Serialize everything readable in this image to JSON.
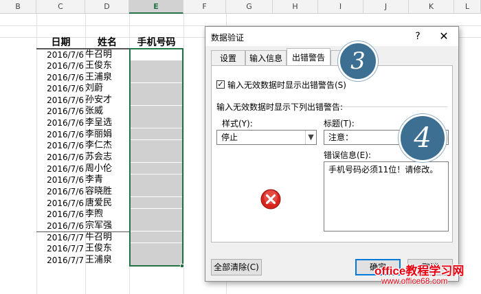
{
  "sheet": {
    "columns": [
      "B",
      "C",
      "D",
      "E",
      "F",
      "G",
      "H",
      "I",
      "J",
      "K",
      "L"
    ],
    "selected_column": "E",
    "headers": {
      "date": "日期",
      "name": "姓名",
      "phone": "手机号码"
    },
    "rows": [
      {
        "date": "2016/7/6",
        "name": "牛召明"
      },
      {
        "date": "2016/7/6",
        "name": "王俊东"
      },
      {
        "date": "2016/7/6",
        "name": "王浦泉"
      },
      {
        "date": "2016/7/6",
        "name": "刘蔚"
      },
      {
        "date": "2016/7/6",
        "name": "孙安才"
      },
      {
        "date": "2016/7/6",
        "name": "张威"
      },
      {
        "date": "2016/7/6",
        "name": "李呈选"
      },
      {
        "date": "2016/7/6",
        "name": "李丽娟"
      },
      {
        "date": "2016/7/6",
        "name": "李仁杰"
      },
      {
        "date": "2016/7/6",
        "name": "苏会志"
      },
      {
        "date": "2016/7/6",
        "name": "周小伦"
      },
      {
        "date": "2016/7/6",
        "name": "李青"
      },
      {
        "date": "2016/7/6",
        "name": "容晓胜"
      },
      {
        "date": "2016/7/6",
        "name": "唐爱民"
      },
      {
        "date": "2016/7/6",
        "name": "李煦"
      },
      {
        "date": "2016/7/6",
        "name": "宗军强"
      },
      {
        "date": "2016/7/7",
        "name": "牛召明"
      },
      {
        "date": "2016/7/7",
        "name": "王俊东"
      },
      {
        "date": "2016/7/7",
        "name": "王浦泉"
      }
    ]
  },
  "dialog": {
    "title": "数据验证",
    "help": "?",
    "close": "✕",
    "tabs": [
      "设置",
      "输入信息",
      "出错警告",
      ""
    ],
    "active_tab": "出错警告",
    "show_alert_checkbox": {
      "checked": true,
      "mark": "✓",
      "label": "输入无效数据时显示出错警告(S)"
    },
    "section_label": "输入无效数据时显示下列出错警告:",
    "style_label": "样式(Y):",
    "style_value": "停止",
    "title_label": "标题(T):",
    "title_value": "注意：",
    "message_label": "错误信息(E):",
    "message_value": "手机号码必须11位！请修改。",
    "error_icon": "stop-error-icon",
    "clear_all_button": "全部清除(C)",
    "ok_button": "确定",
    "cancel_button": "取消"
  },
  "annotations": {
    "step3": "3",
    "step4": "4"
  },
  "watermark": {
    "line1": "office教程学习网",
    "line2": "www.office68.com"
  },
  "colors": {
    "excel_green": "#217346",
    "step_circle": "#3d6f93",
    "watermark_red": "#e60012",
    "error_red": "#d9231d"
  }
}
